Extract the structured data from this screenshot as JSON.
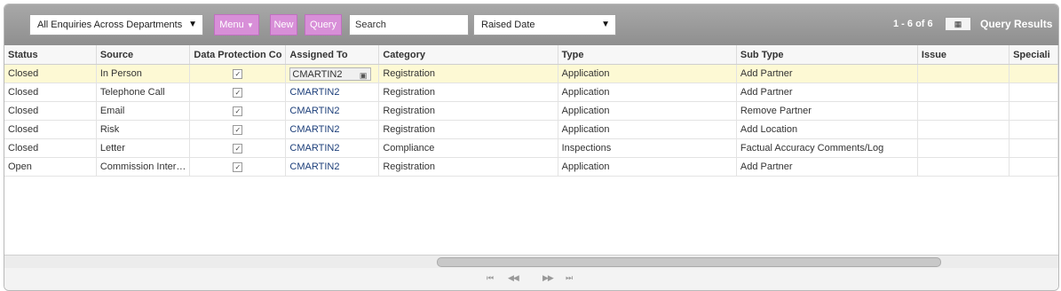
{
  "toolbar": {
    "view_select": "All Enquiries Across Departments",
    "menu_label": "Menu",
    "new_label": "New",
    "query_label": "Query",
    "search_placeholder": "Search",
    "sort_select": "Raised Date",
    "result_count": "1 - 6 of 6",
    "query_results_label": "Query Results"
  },
  "grid": {
    "columns": [
      "Status",
      "Source",
      "Data Protection Co",
      "Assigned To",
      "Category",
      "Type",
      "Sub Type",
      "Issue",
      "Speciali"
    ],
    "rows": [
      {
        "status": "Closed",
        "source": "In Person",
        "data_protection": true,
        "assigned_to": "CMARTIN2",
        "category": "Registration",
        "type": "Application",
        "sub_type": "Add Partner",
        "issue": "",
        "specialism": ""
      },
      {
        "status": "Closed",
        "source": "Telephone Call",
        "data_protection": true,
        "assigned_to": "CMARTIN2",
        "category": "Registration",
        "type": "Application",
        "sub_type": "Add Partner",
        "issue": "",
        "specialism": ""
      },
      {
        "status": "Closed",
        "source": "Email",
        "data_protection": true,
        "assigned_to": "CMARTIN2",
        "category": "Registration",
        "type": "Application",
        "sub_type": "Remove Partner",
        "issue": "",
        "specialism": ""
      },
      {
        "status": "Closed",
        "source": "Risk",
        "data_protection": true,
        "assigned_to": "CMARTIN2",
        "category": "Registration",
        "type": "Application",
        "sub_type": "Add Location",
        "issue": "",
        "specialism": ""
      },
      {
        "status": "Closed",
        "source": "Letter",
        "data_protection": true,
        "assigned_to": "CMARTIN2",
        "category": "Compliance",
        "type": "Inspections",
        "sub_type": "Factual Accuracy Comments/Log",
        "issue": "",
        "specialism": ""
      },
      {
        "status": "Open",
        "source": "Commission Inter…",
        "data_protection": true,
        "assigned_to": "CMARTIN2",
        "category": "Registration",
        "type": "Application",
        "sub_type": "Add Partner",
        "issue": "",
        "specialism": ""
      }
    ]
  },
  "pager": {
    "first": "⏮",
    "prev": "◀◀",
    "next": "▶▶",
    "last": "⏭"
  }
}
